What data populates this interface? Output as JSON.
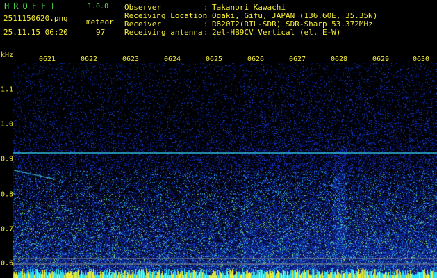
{
  "app": {
    "logo": "HROFFT",
    "version": "1.0.0"
  },
  "file": {
    "name": "2511150620.png",
    "datetime": "25.11.15 06:20"
  },
  "detection": {
    "label": "meteor",
    "count": "97"
  },
  "info": {
    "observer_label": "Observer",
    "observer_value": "Takanori Kawachi",
    "location_label": "Receiving Location",
    "location_value": "Ogaki, Gifu, JAPAN (136.60E, 35.35N)",
    "receiver_label": "Receiver",
    "receiver_value": "R820T2(RTL-SDR) SDR-Sharp 53.372MHz",
    "antenna_label": "Receiving antenna",
    "antenna_value": "2el-HB9CV Vertical (el. E-W)",
    "colon": ":"
  },
  "axes": {
    "y_unit": "kHz",
    "y_ticks": [
      "1.1",
      "1.0",
      "0.9",
      "0.8",
      "0.7",
      "0.6"
    ],
    "x_ticks": [
      "0621",
      "0622",
      "0623",
      "0624",
      "0625",
      "0626",
      "0627",
      "0628",
      "0629",
      "0630"
    ]
  },
  "colors": {
    "header_text": "#f7ee3a",
    "logo": "#4ee14e",
    "carrier_line": "#36c8e8",
    "background_noise": "#0a1a70"
  }
}
